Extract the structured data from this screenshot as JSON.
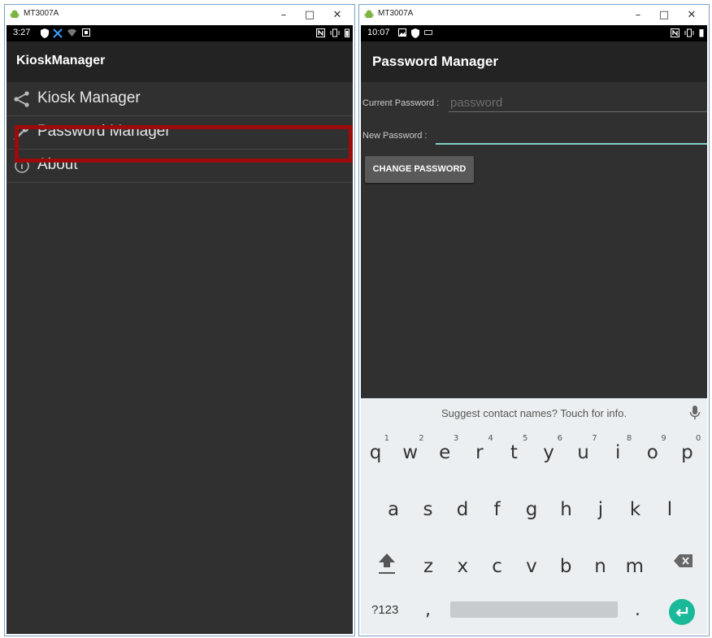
{
  "left_window": {
    "title": "MT3007A",
    "window_controls": {
      "minimize": "–",
      "maximize": "□",
      "close": "✕"
    },
    "status": {
      "time": "3:27"
    },
    "app_title": "KioskManager",
    "menu": [
      {
        "label": "Kiosk Manager",
        "icon": "share-icon"
      },
      {
        "label": "Password Manager",
        "icon": "wrench-icon"
      },
      {
        "label": "About",
        "icon": "info-icon"
      }
    ],
    "highlight_color": "#9c0a0a"
  },
  "right_window": {
    "title": "MT3007A",
    "window_controls": {
      "minimize": "–",
      "maximize": "□",
      "close": "✕"
    },
    "status": {
      "time": "10:07"
    },
    "app_title": "Password Manager",
    "form": {
      "current_label": "Current Password :",
      "current_placeholder": "password",
      "new_label": "New Password :",
      "new_value": "",
      "button_label": "CHANGE PASSWORD"
    },
    "keyboard": {
      "suggestion": "Suggest contact names? Touch for info.",
      "row1": [
        {
          "k": "q",
          "h": "1"
        },
        {
          "k": "w",
          "h": "2"
        },
        {
          "k": "e",
          "h": "3"
        },
        {
          "k": "r",
          "h": "4"
        },
        {
          "k": "t",
          "h": "5"
        },
        {
          "k": "y",
          "h": "6"
        },
        {
          "k": "u",
          "h": "7"
        },
        {
          "k": "i",
          "h": "8"
        },
        {
          "k": "o",
          "h": "9"
        },
        {
          "k": "p",
          "h": "0"
        }
      ],
      "row2": [
        "a",
        "s",
        "d",
        "f",
        "g",
        "h",
        "j",
        "k",
        "l"
      ],
      "row3": [
        "z",
        "x",
        "c",
        "v",
        "b",
        "n",
        "m"
      ],
      "symbols_key": "?123",
      "comma_key": ",",
      "period_key": ".",
      "accent_color": "#1ab99a",
      "underline_active_color": "#7fd3c2"
    }
  }
}
